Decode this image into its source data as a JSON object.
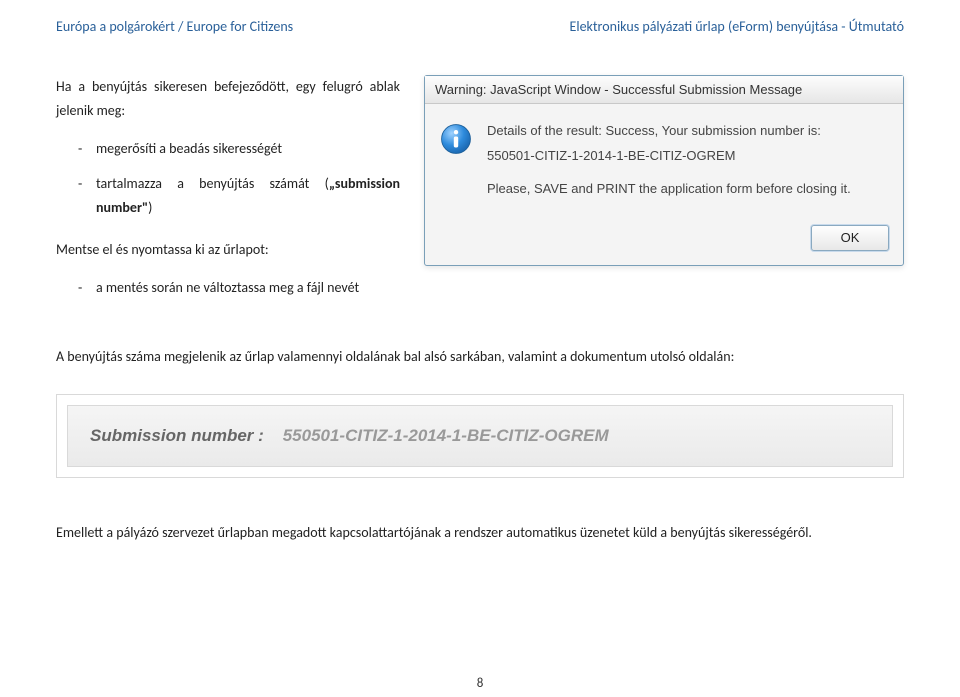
{
  "header": {
    "left": "Európa a polgárokért / Europe for Citizens",
    "right": "Elektronikus pályázati űrlap (eForm) benyújtása - Útmutató"
  },
  "intro": "Ha a benyújtás sikeresen befejeződött, egy felugró ablak jelenik meg:",
  "list1": {
    "item1_prefix": "megerősíti a beadás sikerességét",
    "item2_prefix": "tartalmazza a benyújtás számát (",
    "item2_bold": "„submission number\"",
    "item2_suffix": ")"
  },
  "save_print_intro": "Mentse el és nyomtassa ki az űrlapot:",
  "list2": {
    "item1": "a mentés során ne változtassa meg a fájl nevét"
  },
  "dialog": {
    "title": "Warning: JavaScript Window - Successful Submission Message",
    "line1": "Details of the result: Success, Your submission number is:",
    "line2": "550501-CITIZ-1-2014-1-BE-CITIZ-OGREM",
    "line3": "Please, SAVE and PRINT the application form before closing it.",
    "ok": "OK"
  },
  "below1": "A benyújtás száma megjelenik az űrlap valamennyi oldalának bal alsó sarkában, valamint a dokumentum utolsó oldalán:",
  "submission_banner": {
    "label": "Submission number :",
    "value": "550501-CITIZ-1-2014-1-BE-CITIZ-OGREM"
  },
  "below2": "Emellett a pályázó szervezet űrlapban megadott kapcsolattartójának a rendszer automatikus üzenetet küld a benyújtás sikerességéről.",
  "page_number": "8"
}
